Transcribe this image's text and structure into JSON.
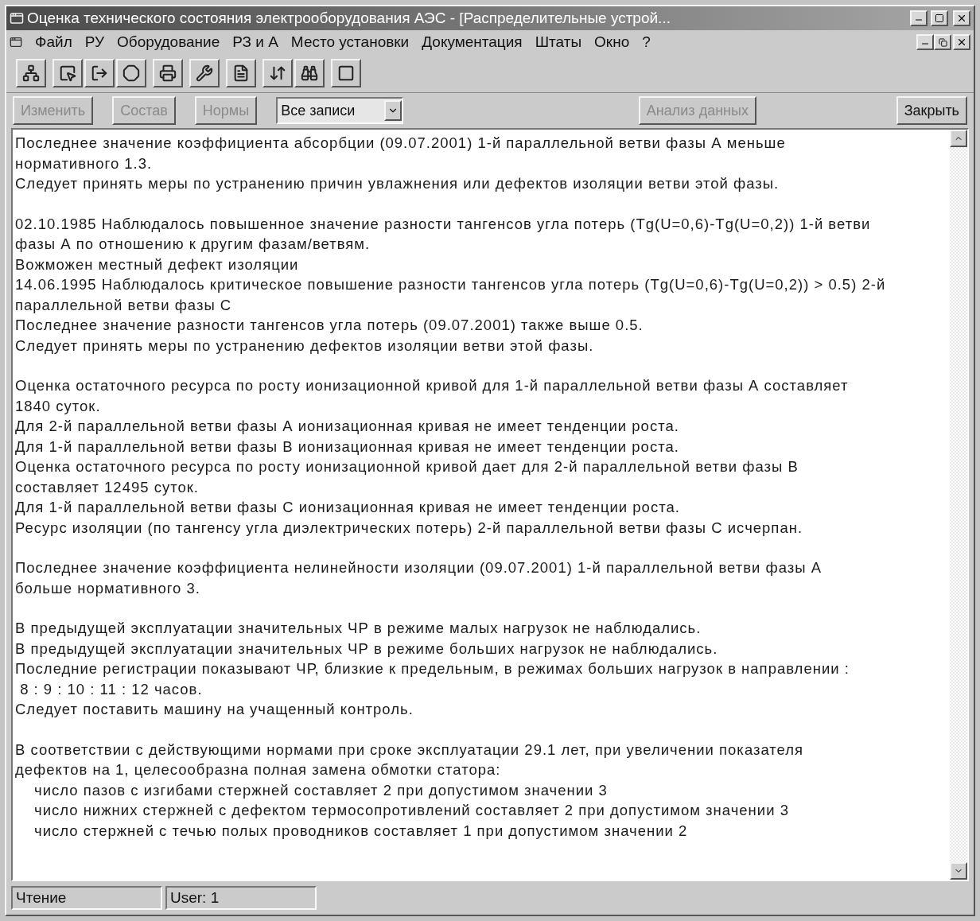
{
  "window": {
    "title": "Оценка технического состояния электрооборудования АЭС - [Распределительные устрой..."
  },
  "menu": [
    "Файл",
    "РУ",
    "Оборудование",
    "РЗ и А",
    "Место установки",
    "Документация",
    "Штаты",
    "Окно",
    "?"
  ],
  "actions": [
    {
      "kind": "button",
      "label": "Изменить",
      "disabled": true
    },
    {
      "kind": "button",
      "label": "Состав",
      "disabled": true
    },
    {
      "kind": "button",
      "label": "Нормы",
      "disabled": true
    },
    {
      "kind": "dropdown",
      "label": "Все записи",
      "disabled": false
    },
    {
      "kind": "button",
      "label": "Анализ данных",
      "disabled": true
    },
    {
      "kind": "button",
      "label": "Закрыть",
      "disabled": false
    }
  ],
  "report": {
    "paragraphs": [
      {
        "lines": [
          "Последнее значение коэффициента абсорбции (09.07.2001) 1-й параллельной ветви фазы А меньше",
          "нормативного 1.3.",
          "Следует принять меры по устранению причин увлажнения или дефектов изоляции ветви этой фазы."
        ]
      },
      {
        "lines": [
          "02.10.1985 Наблюдалось повышенное значение разности тангенсов угла потерь (Tg(U=0,6)-Tg(U=0,2)) 1-й ветви",
          "фазы А по отношению к другим фазам/ветвям.",
          "Вожможен местный дефект изоляции",
          "14.06.1995 Наблюдалось критическое повышение разности тангенсов угла потерь (Tg(U=0,6)-Tg(U=0,2)) > 0.5) 2-й",
          "параллельной ветви фазы С",
          "Последнее значение разности тангенсов угла потерь (09.07.2001) также выше 0.5.",
          "Следует принять меры по устранению дефектов изоляции ветви этой фазы."
        ]
      },
      {
        "lines": [
          "Оценка остаточного ресурса по росту ионизационной кривой для 1-й параллельной ветви фазы А составляет",
          "1840 суток.",
          "Для 2-й параллельной ветви фазы А ионизационная кривая не имеет тенденции роста.",
          "Для 1-й параллельной ветви фазы В ионизационная кривая не имеет тенденции роста.",
          "Оценка остаточного ресурса по росту ионизационной кривой дает для 2-й параллельной ветви фазы В",
          "составляет 12495 суток.",
          "Для 1-й параллельной ветви фазы С ионизационная кривая не имеет тенденции роста.",
          "Ресурс изоляции (по тангенсу угла диэлектрических потерь) 2-й параллельной ветви фазы С исчерпан."
        ]
      },
      {
        "lines": [
          "Последнее значение коэффициента нелинейности изоляции (09.07.2001) 1-й параллельной ветви фазы А",
          "больше нормативного 3."
        ]
      },
      {
        "lines": [
          "В предыдущей эксплуатации значительных ЧР в режиме малых нагрузок не наблюдались.",
          "В предыдущей эксплуатации значительных ЧР в режиме больших нагрузок не наблюдались.",
          "Последние регистрации показывают ЧР, близкие к предельным, в режимах больших нагрузок в направлении :",
          " 8 : 9 : 10 : 11 : 12 часов.",
          "Следует поставить машину на учащенный контроль."
        ]
      },
      {
        "lines": [
          "В соответствии с действующими нормами при сроке эксплуатации 29.1 лет, при увеличении показателя",
          "дефектов на 1, целесообразна полная замена обмотки статора:"
        ],
        "items": [
          "число пазов с изгибами стержней составляет 2 при допустимом значении 3",
          "число нижних стержней с дефектом термосопротивлений составляет 2 при допустимом значении 3",
          "число стержней с течью полых проводников составляет 1 при допустимом значении 2"
        ]
      }
    ]
  },
  "status_bar": [
    "Чтение",
    "User: 1"
  ]
}
